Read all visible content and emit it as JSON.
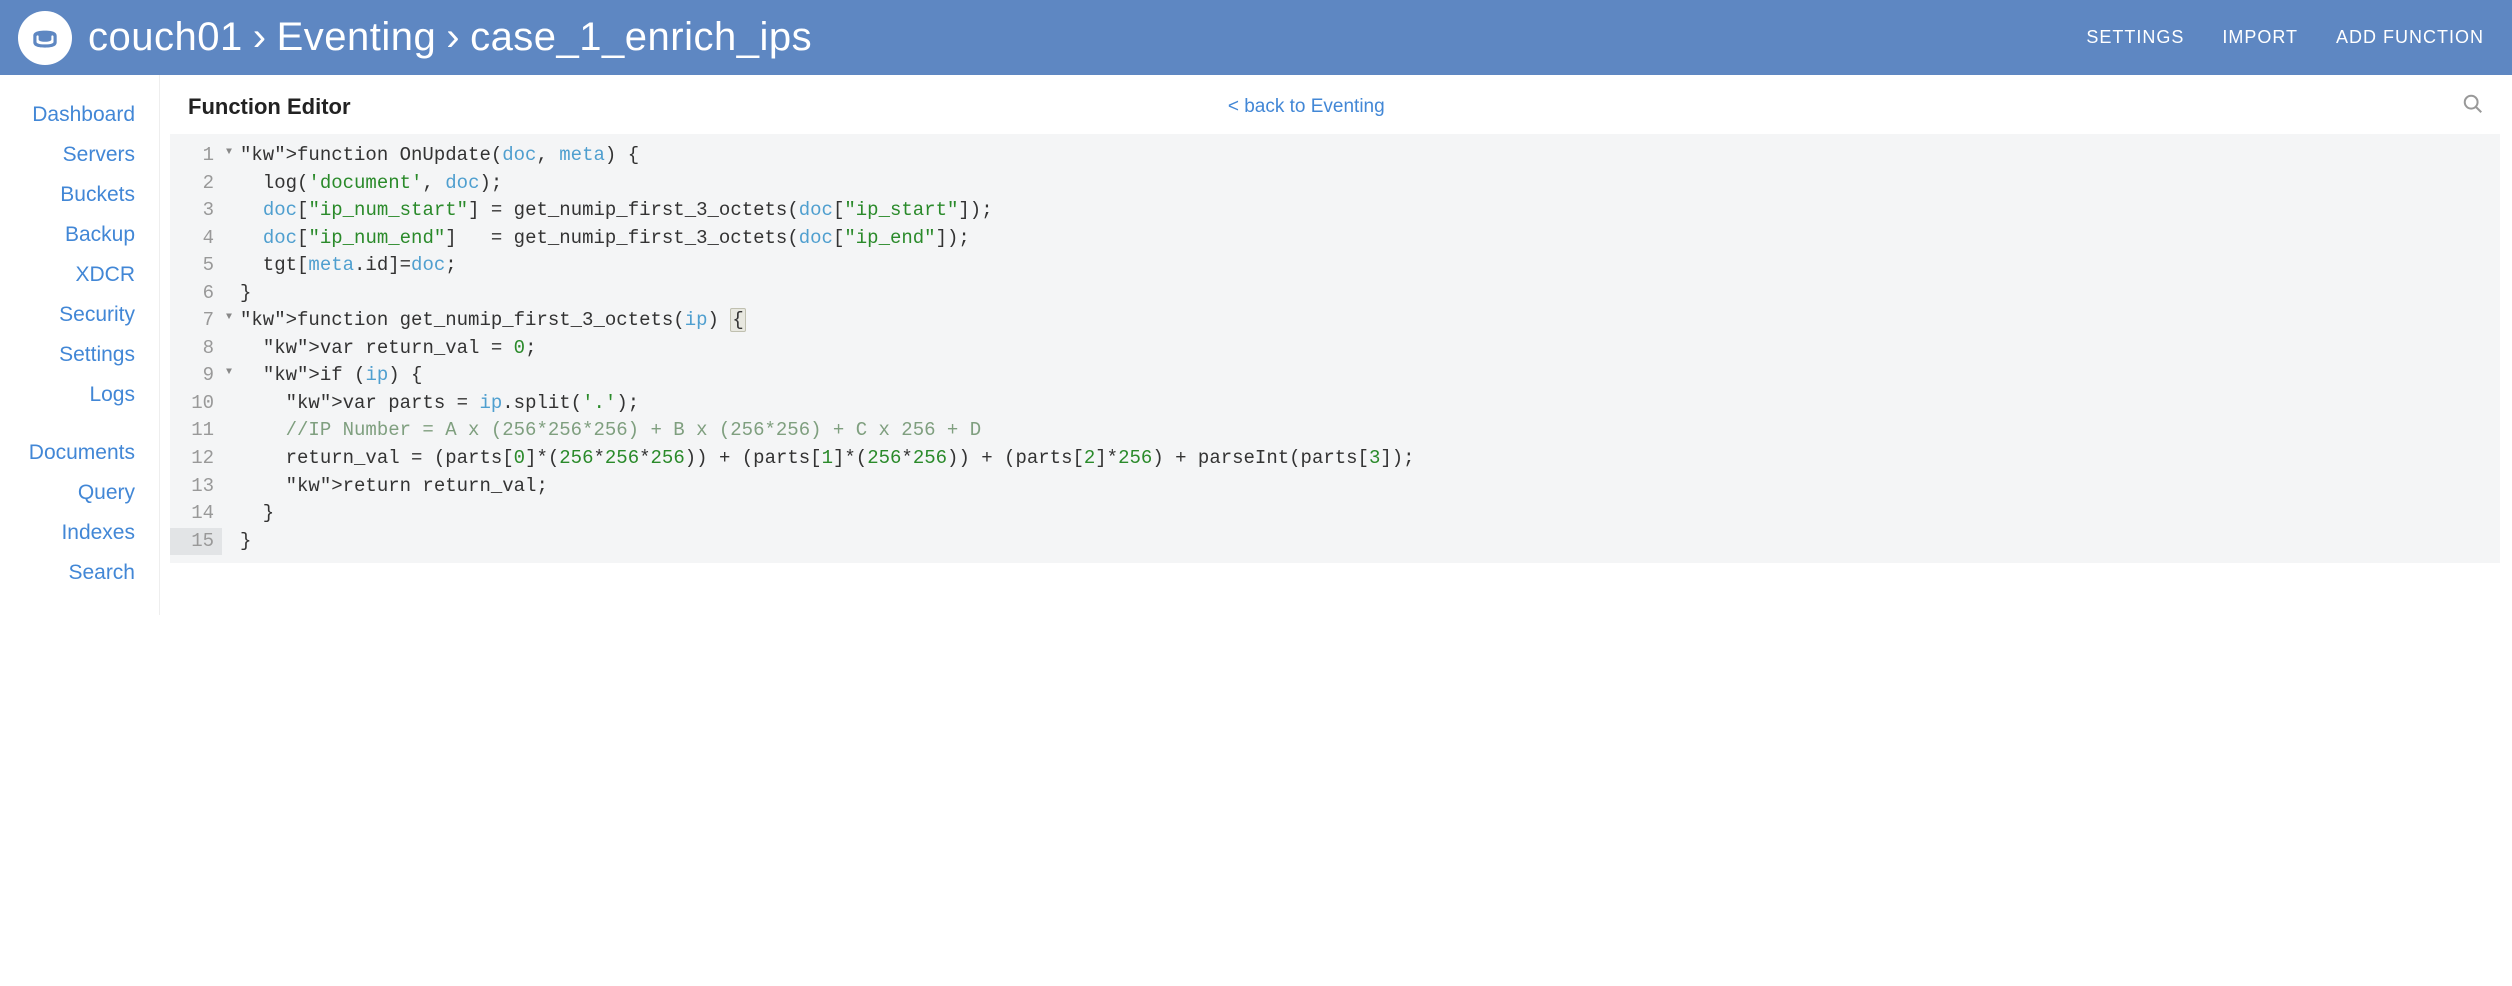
{
  "header": {
    "breadcrumb": [
      "couch01",
      "Eventing",
      "case_1_enrich_ips"
    ],
    "actions": {
      "settings": "SETTINGS",
      "import": "IMPORT",
      "add_function": "ADD FUNCTION"
    }
  },
  "sidebar": {
    "group1": [
      {
        "label": "Dashboard"
      },
      {
        "label": "Servers"
      },
      {
        "label": "Buckets"
      },
      {
        "label": "Backup"
      },
      {
        "label": "XDCR"
      },
      {
        "label": "Security"
      },
      {
        "label": "Settings"
      },
      {
        "label": "Logs"
      }
    ],
    "group2": [
      {
        "label": "Documents"
      },
      {
        "label": "Query"
      },
      {
        "label": "Indexes"
      },
      {
        "label": "Search"
      }
    ]
  },
  "editor": {
    "title": "Function Editor",
    "back_label": "< back to Eventing",
    "code_lines": [
      {
        "n": 1,
        "fold": true,
        "raw": "function OnUpdate(doc, meta) {"
      },
      {
        "n": 2,
        "fold": false,
        "raw": "  log('document', doc);"
      },
      {
        "n": 3,
        "fold": false,
        "raw": "  doc[\"ip_num_start\"] = get_numip_first_3_octets(doc[\"ip_start\"]);"
      },
      {
        "n": 4,
        "fold": false,
        "raw": "  doc[\"ip_num_end\"]   = get_numip_first_3_octets(doc[\"ip_end\"]);"
      },
      {
        "n": 5,
        "fold": false,
        "raw": "  tgt[meta.id]=doc;"
      },
      {
        "n": 6,
        "fold": false,
        "raw": "}"
      },
      {
        "n": 7,
        "fold": true,
        "raw": "function get_numip_first_3_octets(ip) {"
      },
      {
        "n": 8,
        "fold": false,
        "raw": "  var return_val = 0;"
      },
      {
        "n": 9,
        "fold": true,
        "raw": "  if (ip) {"
      },
      {
        "n": 10,
        "fold": false,
        "raw": "    var parts = ip.split('.');"
      },
      {
        "n": 11,
        "fold": false,
        "raw": "    //IP Number = A x (256*256*256) + B x (256*256) + C x 256 + D"
      },
      {
        "n": 12,
        "fold": false,
        "raw": "    return_val = (parts[0]*(256*256*256)) + (parts[1]*(256*256)) + (parts[2]*256) + parseInt(parts[3]);"
      },
      {
        "n": 13,
        "fold": false,
        "raw": "    return return_val;"
      },
      {
        "n": 14,
        "fold": false,
        "raw": "  }"
      },
      {
        "n": 15,
        "fold": false,
        "raw": "}",
        "cursor": true
      }
    ]
  }
}
